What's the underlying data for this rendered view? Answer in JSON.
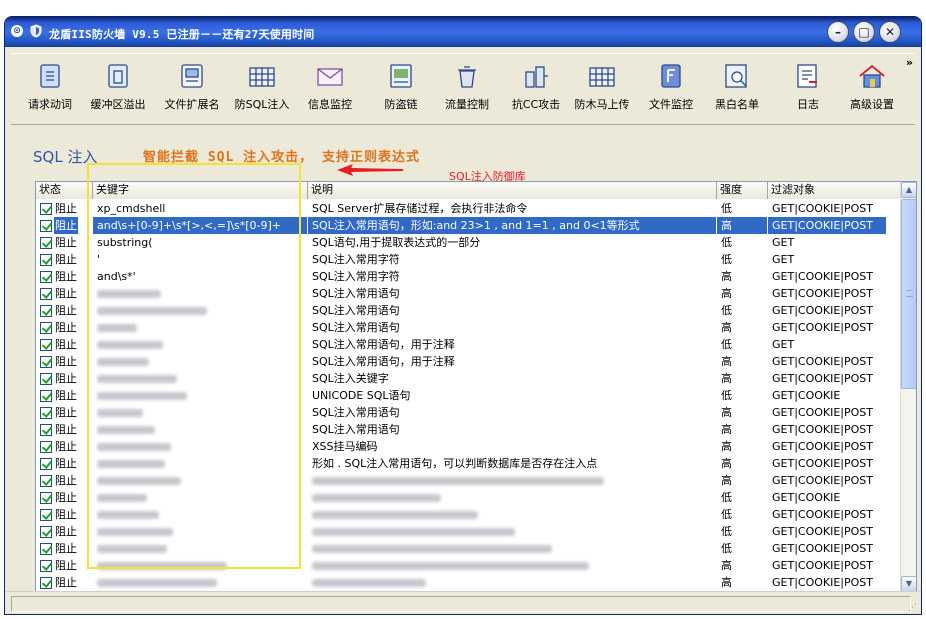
{
  "window": {
    "title": "龙盾IIS防火墙 V9.5 已注册－－还有27天使用时间",
    "sysmenu_icon": "circle-menu-icon",
    "buttons": [
      "minimize-icon",
      "maximize-icon",
      "close-icon"
    ],
    "button_glyphs": {
      "minimize": "–",
      "maximize": "□",
      "close": "✕"
    }
  },
  "toolbar": {
    "items": [
      {
        "label": "请求动词",
        "icon": "verb-doc-icon"
      },
      {
        "label": "缓冲区溢出",
        "icon": "buffer-icon"
      },
      {
        "label": "文件扩展名",
        "icon": "extension-icon"
      },
      {
        "label": "防SQL注入",
        "icon": "database-grid-icon"
      },
      {
        "label": "信息监控",
        "icon": "envelope-icon"
      },
      {
        "label": "防盗链",
        "icon": "image-icon"
      },
      {
        "label": "流量控制",
        "icon": "trash-icon"
      },
      {
        "label": "抗CC攻击",
        "icon": "tower-icon"
      },
      {
        "label": "防木马上传",
        "icon": "grid-icon"
      },
      {
        "label": "文件监控",
        "icon": "file-f-icon"
      },
      {
        "label": "黑白名单",
        "icon": "search-list-icon"
      },
      {
        "label": "日志",
        "icon": "log-icon"
      },
      {
        "label": "高级设置",
        "icon": "house-icon"
      }
    ],
    "more_glyph": "»"
  },
  "page": {
    "heading": "SQL 注入",
    "subheading": "智能拦截 SQL 注入攻击， 支持正则表达式",
    "annotation": "SQL注入防御库"
  },
  "table": {
    "columns": [
      "状态",
      "关键字",
      "说明",
      "强度",
      "过滤对象"
    ],
    "rows": [
      {
        "state": "阻止",
        "keyword": "xp_cmdshell",
        "desc": "SQL Server扩展存储过程，会执行非法命令",
        "level": "低",
        "target": "GET|COOKIE|POST"
      },
      {
        "state": "阻止",
        "keyword": "and\\s+[0-9]+\\s*[>,<,=]\\s*[0-9]+",
        "desc": "SQL注入常用语句，形如:and 23>1 , and 1=1 , and 0<1等形式",
        "level": "高",
        "target": "GET|COOKIE|POST",
        "selected": true
      },
      {
        "state": "阻止",
        "keyword": "substring(",
        "desc": "SQL语句,用于提取表达式的一部分",
        "level": "低",
        "target": "GET"
      },
      {
        "state": "阻止",
        "keyword": "'",
        "desc": "SQL注入常用字符",
        "level": "低",
        "target": "GET"
      },
      {
        "state": "阻止",
        "keyword": "and\\s*'",
        "desc": "SQL注入常用字符",
        "level": "高",
        "target": "GET|COOKIE|POST"
      },
      {
        "state": "阻止",
        "keyword": "",
        "desc": "SQL注入常用语句",
        "level": "高",
        "target": "GET|COOKIE|POST"
      },
      {
        "state": "阻止",
        "keyword": "",
        "desc": "SQL注入常用语句",
        "level": "低",
        "target": "GET|COOKIE|POST"
      },
      {
        "state": "阻止",
        "keyword": "",
        "desc": "SQL注入常用语句",
        "level": "高",
        "target": "GET|COOKIE|POST"
      },
      {
        "state": "阻止",
        "keyword": "",
        "desc": "SQL注入常用语句，用于注释",
        "level": "低",
        "target": "GET"
      },
      {
        "state": "阻止",
        "keyword": "",
        "desc": "SQL注入常用语句，用于注释",
        "level": "高",
        "target": "GET|COOKIE|POST"
      },
      {
        "state": "阻止",
        "keyword": "",
        "desc": "SQL注入关键字",
        "level": "高",
        "target": "GET|COOKIE|POST"
      },
      {
        "state": "阻止",
        "keyword": "",
        "desc": "UNICODE SQL语句",
        "level": "低",
        "target": "GET|COOKIE"
      },
      {
        "state": "阻止",
        "keyword": "",
        "desc": "SQL注入常用语句",
        "level": "高",
        "target": "GET|COOKIE|POST"
      },
      {
        "state": "阻止",
        "keyword": "",
        "desc": "SQL注入常用语句",
        "level": "高",
        "target": "GET|COOKIE|POST"
      },
      {
        "state": "阻止",
        "keyword": "",
        "desc": "XSS挂马编码",
        "level": "高",
        "target": "GET|COOKIE|POST"
      },
      {
        "state": "阻止",
        "keyword": "",
        "desc": "形如 . SQL注入常用语句，可以判断数据库是否存在注入点",
        "level": "高",
        "target": "GET|COOKIE|POST"
      },
      {
        "state": "阻止",
        "keyword": "",
        "desc": "",
        "level": "高",
        "target": "GET|COOKIE|POST"
      },
      {
        "state": "阻止",
        "keyword": "",
        "desc": "",
        "level": "低",
        "target": "GET|COOKIE"
      },
      {
        "state": "阻止",
        "keyword": "",
        "desc": "",
        "level": "低",
        "target": "GET|COOKIE|POST"
      },
      {
        "state": "阻止",
        "keyword": "",
        "desc": "",
        "level": "低",
        "target": "GET|COOKIE|POST"
      },
      {
        "state": "阻止",
        "keyword": "",
        "desc": "",
        "level": "低",
        "target": "GET|COOKIE|POST"
      },
      {
        "state": "阻止",
        "keyword": "",
        "desc": "",
        "level": "高",
        "target": "GET|COOKIE|POST"
      },
      {
        "state": "阻止",
        "keyword": "",
        "desc": "",
        "level": "高",
        "target": "GET|COOKIE|POST"
      }
    ]
  },
  "scrollbar": {
    "up_glyph": "▲",
    "down_glyph": "▼"
  },
  "statusbar": {
    "grip_glyph": "⋰"
  },
  "colors": {
    "selection": "#316ac5",
    "heading": "#3354aa",
    "subheading": "#e0731b",
    "annotation": "#e81c24",
    "highlight_box": "#f2e336"
  }
}
